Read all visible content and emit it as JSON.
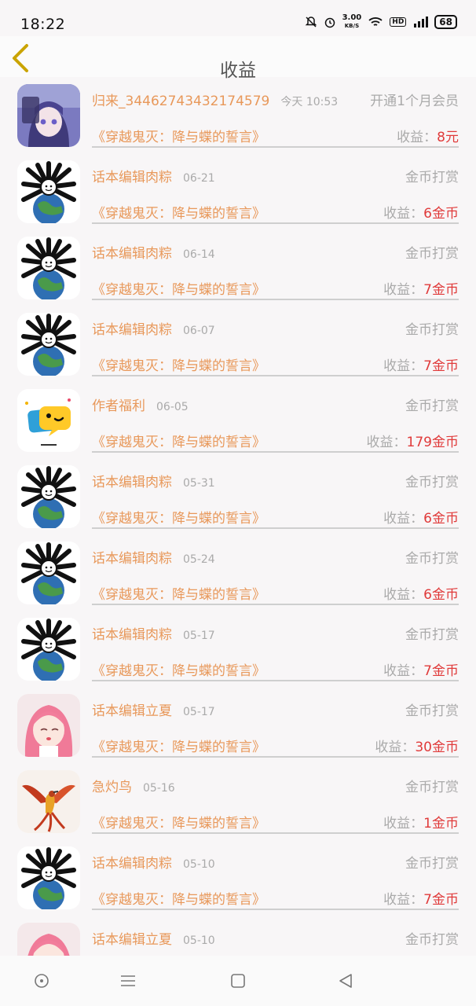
{
  "status_bar": {
    "time": "18:22",
    "net_speed_value": "3.00",
    "net_speed_unit": "KB/S",
    "hd_label": "HD",
    "battery": "68"
  },
  "header": {
    "title": "收益"
  },
  "earnings_label": "收益：",
  "rows": [
    {
      "name": "归来_3446274343217457​9",
      "time": "今天 10:53",
      "type": "开通1个月会员",
      "book": "《穿越鬼灭：降与蝶的誓言》",
      "amount": "8元",
      "avatar": "anime-girl"
    },
    {
      "name": "话本编辑肉粽",
      "time": "06-21",
      "type": "金币打赏",
      "book": "《穿越鬼灭：降与蝶的誓言》",
      "amount": "6金币",
      "avatar": "earth-meme"
    },
    {
      "name": "话本编辑肉粽",
      "time": "06-14",
      "type": "金币打赏",
      "book": "《穿越鬼灭：降与蝶的誓言》",
      "amount": "7金币",
      "avatar": "earth-meme"
    },
    {
      "name": "话本编辑肉粽",
      "time": "06-07",
      "type": "金币打赏",
      "book": "《穿越鬼灭：降与蝶的誓言》",
      "amount": "7金币",
      "avatar": "earth-meme"
    },
    {
      "name": "作者福利",
      "time": "06-05",
      "type": "金币打赏",
      "book": "《穿越鬼灭：降与蝶的誓言》",
      "amount": "179金币",
      "avatar": "chat-bubble"
    },
    {
      "name": "话本编辑肉粽",
      "time": "05-31",
      "type": "金币打赏",
      "book": "《穿越鬼灭：降与蝶的誓言》",
      "amount": "6金币",
      "avatar": "earth-meme"
    },
    {
      "name": "话本编辑肉粽",
      "time": "05-24",
      "type": "金币打赏",
      "book": "《穿越鬼灭：降与蝶的誓言》",
      "amount": "6金币",
      "avatar": "earth-meme"
    },
    {
      "name": "话本编辑肉粽",
      "time": "05-17",
      "type": "金币打赏",
      "book": "《穿越鬼灭：降与蝶的誓言》",
      "amount": "7金币",
      "avatar": "earth-meme"
    },
    {
      "name": "话本编辑立夏",
      "time": "05-17",
      "type": "金币打赏",
      "book": "《穿越鬼灭：降与蝶的誓言》",
      "amount": "30金币",
      "avatar": "pink-hair-girl"
    },
    {
      "name": "急灼鸟",
      "time": "05-16",
      "type": "金币打赏",
      "book": "《穿越鬼灭：降与蝶的誓言》",
      "amount": "1金币",
      "avatar": "phoenix"
    },
    {
      "name": "话本编辑肉粽",
      "time": "05-10",
      "type": "金币打赏",
      "book": "《穿越鬼灭：降与蝶的誓言》",
      "amount": "7金币",
      "avatar": "earth-meme"
    },
    {
      "name": "话本编辑立夏",
      "time": "05-10",
      "type": "金币打赏",
      "book": "",
      "amount": "",
      "avatar": "pink-hair-girl"
    }
  ],
  "colors": {
    "accent": "#e8985a",
    "amount": "#e03a3a",
    "muted": "#aaaaaa"
  }
}
